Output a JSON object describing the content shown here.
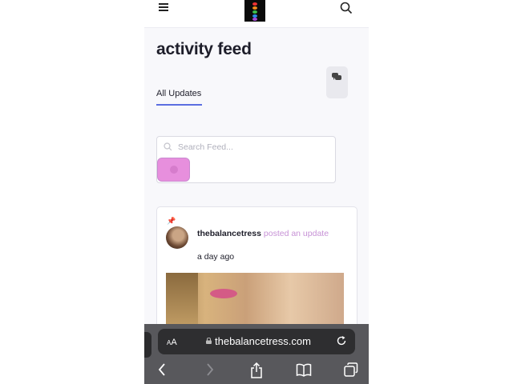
{
  "page": {
    "title": "activity feed"
  },
  "tabs": [
    {
      "label": "All Updates"
    }
  ],
  "search": {
    "placeholder": "Search Feed..."
  },
  "post": {
    "author": "thebalancetress",
    "action": "posted an update",
    "time": "a day ago"
  },
  "browser": {
    "aa_small": "A",
    "aa_large": "A",
    "url": "thebalancetress.com"
  },
  "colors": {
    "accent": "#5b6ee1",
    "filter_button": "#e78fdd",
    "action_text": "#c792d6"
  },
  "icons": [
    "hamburger-menu-icon",
    "site-logo",
    "search-icon",
    "pin-icon",
    "filter-icon",
    "comment-icon",
    "lock-icon",
    "reload-icon",
    "back-icon",
    "forward-icon",
    "share-icon",
    "bookmarks-icon",
    "tabs-icon"
  ]
}
